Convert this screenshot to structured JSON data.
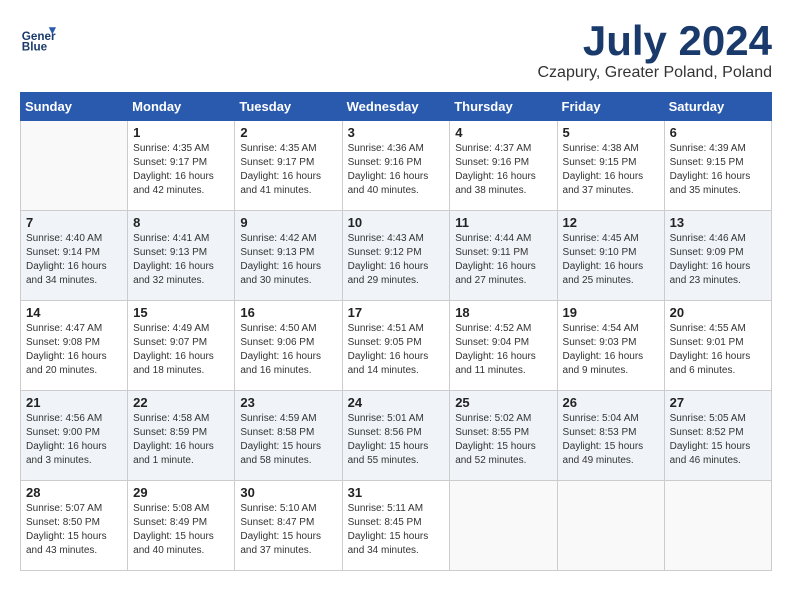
{
  "header": {
    "logo_line1": "General",
    "logo_line2": "Blue",
    "month_year": "July 2024",
    "location": "Czapury, Greater Poland, Poland"
  },
  "days_of_week": [
    "Sunday",
    "Monday",
    "Tuesday",
    "Wednesday",
    "Thursday",
    "Friday",
    "Saturday"
  ],
  "weeks": [
    [
      {
        "day": "",
        "info": ""
      },
      {
        "day": "1",
        "info": "Sunrise: 4:35 AM\nSunset: 9:17 PM\nDaylight: 16 hours\nand 42 minutes."
      },
      {
        "day": "2",
        "info": "Sunrise: 4:35 AM\nSunset: 9:17 PM\nDaylight: 16 hours\nand 41 minutes."
      },
      {
        "day": "3",
        "info": "Sunrise: 4:36 AM\nSunset: 9:16 PM\nDaylight: 16 hours\nand 40 minutes."
      },
      {
        "day": "4",
        "info": "Sunrise: 4:37 AM\nSunset: 9:16 PM\nDaylight: 16 hours\nand 38 minutes."
      },
      {
        "day": "5",
        "info": "Sunrise: 4:38 AM\nSunset: 9:15 PM\nDaylight: 16 hours\nand 37 minutes."
      },
      {
        "day": "6",
        "info": "Sunrise: 4:39 AM\nSunset: 9:15 PM\nDaylight: 16 hours\nand 35 minutes."
      }
    ],
    [
      {
        "day": "7",
        "info": "Sunrise: 4:40 AM\nSunset: 9:14 PM\nDaylight: 16 hours\nand 34 minutes."
      },
      {
        "day": "8",
        "info": "Sunrise: 4:41 AM\nSunset: 9:13 PM\nDaylight: 16 hours\nand 32 minutes."
      },
      {
        "day": "9",
        "info": "Sunrise: 4:42 AM\nSunset: 9:13 PM\nDaylight: 16 hours\nand 30 minutes."
      },
      {
        "day": "10",
        "info": "Sunrise: 4:43 AM\nSunset: 9:12 PM\nDaylight: 16 hours\nand 29 minutes."
      },
      {
        "day": "11",
        "info": "Sunrise: 4:44 AM\nSunset: 9:11 PM\nDaylight: 16 hours\nand 27 minutes."
      },
      {
        "day": "12",
        "info": "Sunrise: 4:45 AM\nSunset: 9:10 PM\nDaylight: 16 hours\nand 25 minutes."
      },
      {
        "day": "13",
        "info": "Sunrise: 4:46 AM\nSunset: 9:09 PM\nDaylight: 16 hours\nand 23 minutes."
      }
    ],
    [
      {
        "day": "14",
        "info": "Sunrise: 4:47 AM\nSunset: 9:08 PM\nDaylight: 16 hours\nand 20 minutes."
      },
      {
        "day": "15",
        "info": "Sunrise: 4:49 AM\nSunset: 9:07 PM\nDaylight: 16 hours\nand 18 minutes."
      },
      {
        "day": "16",
        "info": "Sunrise: 4:50 AM\nSunset: 9:06 PM\nDaylight: 16 hours\nand 16 minutes."
      },
      {
        "day": "17",
        "info": "Sunrise: 4:51 AM\nSunset: 9:05 PM\nDaylight: 16 hours\nand 14 minutes."
      },
      {
        "day": "18",
        "info": "Sunrise: 4:52 AM\nSunset: 9:04 PM\nDaylight: 16 hours\nand 11 minutes."
      },
      {
        "day": "19",
        "info": "Sunrise: 4:54 AM\nSunset: 9:03 PM\nDaylight: 16 hours\nand 9 minutes."
      },
      {
        "day": "20",
        "info": "Sunrise: 4:55 AM\nSunset: 9:01 PM\nDaylight: 16 hours\nand 6 minutes."
      }
    ],
    [
      {
        "day": "21",
        "info": "Sunrise: 4:56 AM\nSunset: 9:00 PM\nDaylight: 16 hours\nand 3 minutes."
      },
      {
        "day": "22",
        "info": "Sunrise: 4:58 AM\nSunset: 8:59 PM\nDaylight: 16 hours\nand 1 minute."
      },
      {
        "day": "23",
        "info": "Sunrise: 4:59 AM\nSunset: 8:58 PM\nDaylight: 15 hours\nand 58 minutes."
      },
      {
        "day": "24",
        "info": "Sunrise: 5:01 AM\nSunset: 8:56 PM\nDaylight: 15 hours\nand 55 minutes."
      },
      {
        "day": "25",
        "info": "Sunrise: 5:02 AM\nSunset: 8:55 PM\nDaylight: 15 hours\nand 52 minutes."
      },
      {
        "day": "26",
        "info": "Sunrise: 5:04 AM\nSunset: 8:53 PM\nDaylight: 15 hours\nand 49 minutes."
      },
      {
        "day": "27",
        "info": "Sunrise: 5:05 AM\nSunset: 8:52 PM\nDaylight: 15 hours\nand 46 minutes."
      }
    ],
    [
      {
        "day": "28",
        "info": "Sunrise: 5:07 AM\nSunset: 8:50 PM\nDaylight: 15 hours\nand 43 minutes."
      },
      {
        "day": "29",
        "info": "Sunrise: 5:08 AM\nSunset: 8:49 PM\nDaylight: 15 hours\nand 40 minutes."
      },
      {
        "day": "30",
        "info": "Sunrise: 5:10 AM\nSunset: 8:47 PM\nDaylight: 15 hours\nand 37 minutes."
      },
      {
        "day": "31",
        "info": "Sunrise: 5:11 AM\nSunset: 8:45 PM\nDaylight: 15 hours\nand 34 minutes."
      },
      {
        "day": "",
        "info": ""
      },
      {
        "day": "",
        "info": ""
      },
      {
        "day": "",
        "info": ""
      }
    ]
  ]
}
